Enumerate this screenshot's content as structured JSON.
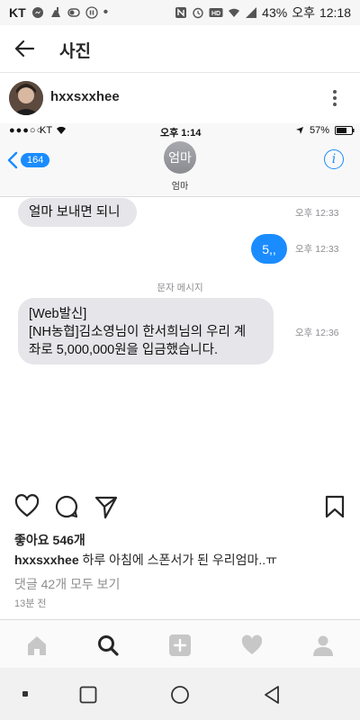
{
  "status_bar": {
    "carrier": "KT",
    "battery": "43%",
    "ampm": "오후",
    "time": "12:18"
  },
  "header": {
    "title": "사진"
  },
  "post": {
    "username": "hxxsxxhee",
    "likes": "좋아요 546개",
    "caption_user": "hxxsxxhee",
    "caption_text": " 하루 아침에 스폰서가 된 우리엄마..ㅠ",
    "comments_link": "댓글 42개 모두 보기",
    "time_ago": "13분 전"
  },
  "message_screenshot": {
    "ios_carrier": "KT",
    "ios_time": "오후 1:14",
    "ios_battery": "57%",
    "back_badge": "164",
    "contact_avatar_text": "엄마",
    "contact_name": "엄마",
    "messages": [
      {
        "text": "얼마 보내면 되니",
        "time": "오후 12:33"
      },
      {
        "text": "5,,",
        "time": "오후 12:33"
      },
      {
        "text_line1": "[Web발신]",
        "text_line2": "[NH농협]김소영님이 한서희님의 우리 계",
        "text_line3": "좌로 5,000,000원을 입금했습니다.",
        "time": "오후 12:36"
      }
    ],
    "section_label": "문자 메시지"
  },
  "colors": {
    "ios_blue": "#1a8cff",
    "bubble_gray": "#e5e5ea",
    "ig_text": "#262626"
  }
}
